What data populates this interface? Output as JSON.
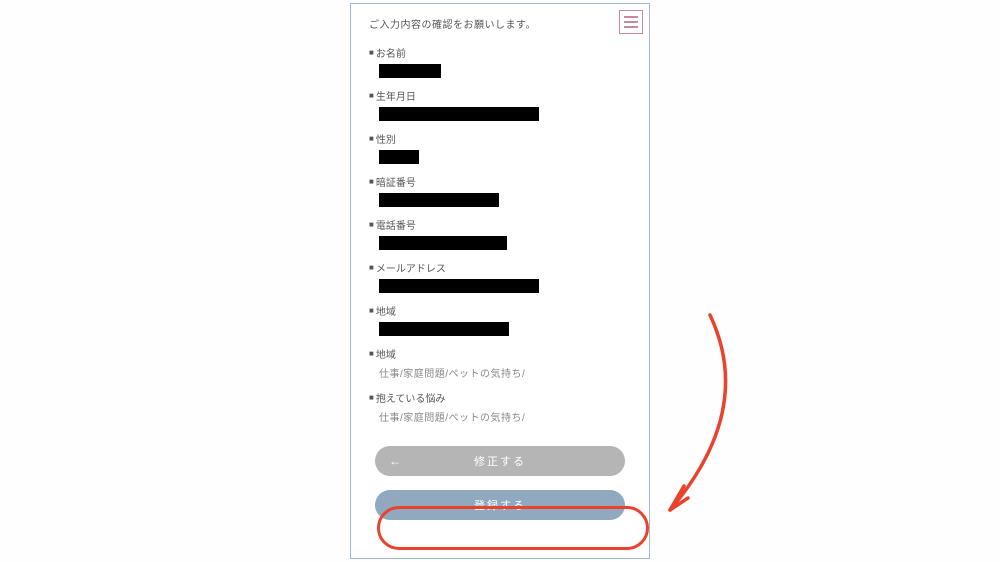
{
  "instruction": "ご入力内容の確認をお願いします。",
  "fields": {
    "name_label": "お名前",
    "dob_label": "生年月日",
    "gender_label": "性別",
    "pin_label": "暗証番号",
    "phone_label": "電話番号",
    "email_label": "メールアドレス",
    "region1_label": "地域",
    "region2_label": "地域",
    "region2_value": "仕事/家庭問題/ペットの気持ち/",
    "concern_label": "抱えている悩み",
    "concern_value": "仕事/家庭問題/ペットの気持ち/"
  },
  "buttons": {
    "back_label": "修正する",
    "submit_label": "登録する"
  }
}
